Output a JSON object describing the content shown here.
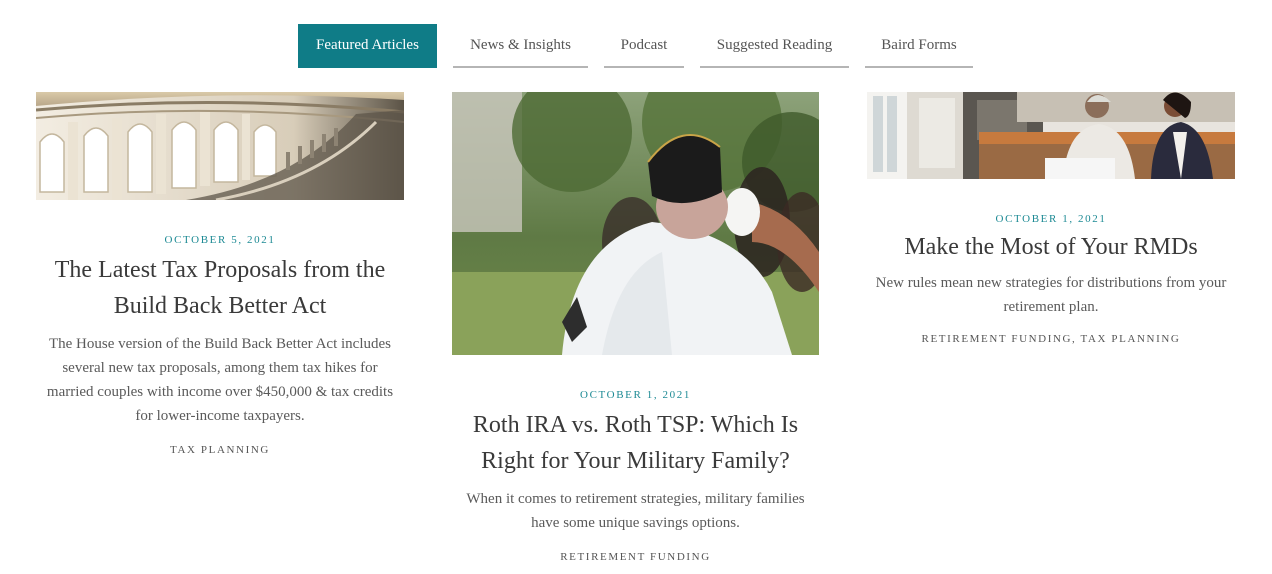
{
  "tabs": [
    {
      "label": "Featured Articles",
      "active": true
    },
    {
      "label": "News & Insights",
      "active": false
    },
    {
      "label": "Podcast",
      "active": false
    },
    {
      "label": "Suggested Reading",
      "active": false
    },
    {
      "label": "Baird Forms",
      "active": false
    }
  ],
  "colors": {
    "accent": "#0f7c87",
    "date_text": "#1d8a94",
    "tab_underline": "#b5b5b5"
  },
  "articles": [
    {
      "date": "OCTOBER 5, 2021",
      "title": "The Latest Tax Proposals from the Build Back Better Act",
      "excerpt": "The House version of the Build Back Better Act includes several new tax proposals, among them tax hikes for married couples with income over $450,000 & tax credits for lower-income taxpayers.",
      "categories": "TAX PLANNING",
      "image": "capitol-dome-interior-photo"
    },
    {
      "date": "OCTOBER 1, 2021",
      "title": "Roth IRA vs. Roth TSP: Which Is Right for Your Military Family?",
      "excerpt": "When it comes to retirement strategies, military families have some unique savings options.",
      "categories": "RETIREMENT FUNDING",
      "image": "veteran-saluting-photo"
    },
    {
      "date": "OCTOBER 1, 2021",
      "title": "Make the Most of Your RMDs",
      "excerpt": "New rules mean new strategies for distributions from your retirement plan.",
      "categories": "RETIREMENT FUNDING, TAX PLANNING",
      "image": "advisor-meeting-kitchen-photo"
    }
  ]
}
